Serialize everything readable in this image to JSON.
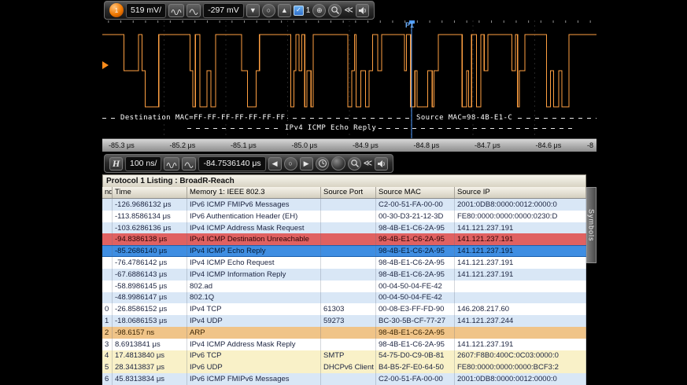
{
  "toolbar_top": {
    "trace_badge": "1",
    "vertical_scale": "519 mV/",
    "vertical_offset": "-297 mV",
    "down_arrow": "▼",
    "center_knob": "○",
    "up_arrow": "▲",
    "checkbox_check": "✓",
    "checkbox_label": "1",
    "zoom_plus": "⊕",
    "chevrons": "≪"
  },
  "toolbar_horizontal": {
    "h_label": "H",
    "timebase": "100 ns/",
    "offset": "-84.7536140 μs",
    "left_arrow": "◀",
    "center_knob": "○",
    "right_arrow": "▶",
    "chevrons": "≪"
  },
  "waveform": {
    "cursor_label": "P1",
    "anno_mac_left": "Destination MAC=FF-FF-FF-FF-FF-FF-FF",
    "anno_mac_right": "Source MAC=98-4B-E1-C",
    "anno_proto": "IPv4 ICMP Echo Reply",
    "trace_color": "#ffa042",
    "cursor_color": "#4f9cff"
  },
  "time_axis": {
    "ticks": [
      "-85.3 μs",
      "-85.2 μs",
      "-85.1 μs",
      "-85.0 μs",
      "-84.9 μs",
      "-84.8 μs",
      "-84.7 μs",
      "-84.6 μs",
      "-8"
    ]
  },
  "listing": {
    "title": "Protocol 1 Listing : BroadR-Reach",
    "side_tab": "Symbols",
    "columns": {
      "index": "ndex",
      "time": "Time",
      "protocol": "Memory 1: IEEE 802.3",
      "source_port": "Source Port",
      "source_mac": "Source MAC",
      "source_ip": "Source IP"
    },
    "rows": [
      {
        "i": "",
        "t": "-126.9686132 μs",
        "p": "IPv6 ICMP FMIPv6 Messages",
        "port": "",
        "mac": "C2-00-51-FA-00-00",
        "ip": "2001:0DB8:0000:0012:0000:0",
        "cls": "b"
      },
      {
        "i": "",
        "t": "-113.8586134 μs",
        "p": "IPv6 Authentication Header (EH)",
        "port": "",
        "mac": "00-30-D3-21-12-3D",
        "ip": "FE80:0000:0000:0000:0230:D",
        "cls": "w"
      },
      {
        "i": "",
        "t": "-103.6286136 μs",
        "p": "IPv4 ICMP Address Mask Request",
        "port": "",
        "mac": "98-4B-E1-C6-2A-95",
        "ip": "141.121.237.191",
        "cls": "b"
      },
      {
        "i": "",
        "t": "-94.8386138 μs",
        "p": "IPv4 ICMP Destination Unreachable",
        "port": "",
        "mac": "98-4B-E1-C6-2A-95",
        "ip": "141.121.237.191",
        "cls": "red"
      },
      {
        "i": "",
        "t": "-85.2686140 μs",
        "p": "IPv4 ICMP Echo Reply",
        "port": "",
        "mac": "98-4B-E1-C6-2A-95",
        "ip": "141.121.237.191",
        "cls": "sel"
      },
      {
        "i": "",
        "t": "-76.4786142 μs",
        "p": "IPv4 ICMP Echo Request",
        "port": "",
        "mac": "98-4B-E1-C6-2A-95",
        "ip": "141.121.237.191",
        "cls": "w"
      },
      {
        "i": "",
        "t": "-67.6886143 μs",
        "p": "IPv4 ICMP Information Reply",
        "port": "",
        "mac": "98-4B-E1-C6-2A-95",
        "ip": "141.121.237.191",
        "cls": "b"
      },
      {
        "i": "",
        "t": "-58.8986145 μs",
        "p": "802.ad",
        "port": "",
        "mac": "00-04-50-04-FE-42",
        "ip": "",
        "cls": "w"
      },
      {
        "i": "",
        "t": "-48.9986147 μs",
        "p": "802.1Q",
        "port": "",
        "mac": "00-04-50-04-FE-42",
        "ip": "",
        "cls": "b"
      },
      {
        "i": "0",
        "t": "-26.8586152 μs",
        "p": "IPv4 TCP",
        "port": "61303",
        "mac": "00-08-E3-FF-FD-90",
        "ip": "146.208.217.60",
        "cls": "w"
      },
      {
        "i": "1",
        "t": "-18.0686153 μs",
        "p": "IPv4 UDP",
        "port": "59273",
        "mac": "BC-30-5B-CF-77-27",
        "ip": "141.121.237.244",
        "cls": "b"
      },
      {
        "i": "2",
        "t": "-98.6157 ns",
        "p": "ARP",
        "port": "",
        "mac": "98-4B-E1-C6-2A-95",
        "ip": "",
        "cls": "tan"
      },
      {
        "i": "3",
        "t": "8.6913841 μs",
        "p": "IPv4 ICMP Address Mask Reply",
        "port": "",
        "mac": "98-4B-E1-C6-2A-95",
        "ip": "141.121.237.191",
        "cls": "w"
      },
      {
        "i": "4",
        "t": "17.4813840 μs",
        "p": "IPv6 TCP",
        "port": "SMTP",
        "mac": "54-75-D0-C9-0B-81",
        "ip": "2607:F8B0:400C:0C03:0000:0",
        "cls": "yel"
      },
      {
        "i": "5",
        "t": "28.3413837 μs",
        "p": "IPv6 UDP",
        "port": "DHCPv6 Client",
        "mac": "B4-B5-2F-E0-64-50",
        "ip": "FE80:0000:0000:0000:BCF3:2",
        "cls": "yel"
      },
      {
        "i": "6",
        "t": "45.8313834 μs",
        "p": "IPv6 ICMP FMIPv6 Messages",
        "port": "",
        "mac": "C2-00-51-FA-00-00",
        "ip": "2001:0DB8:0000:0012:0000:0",
        "cls": "b"
      }
    ]
  }
}
